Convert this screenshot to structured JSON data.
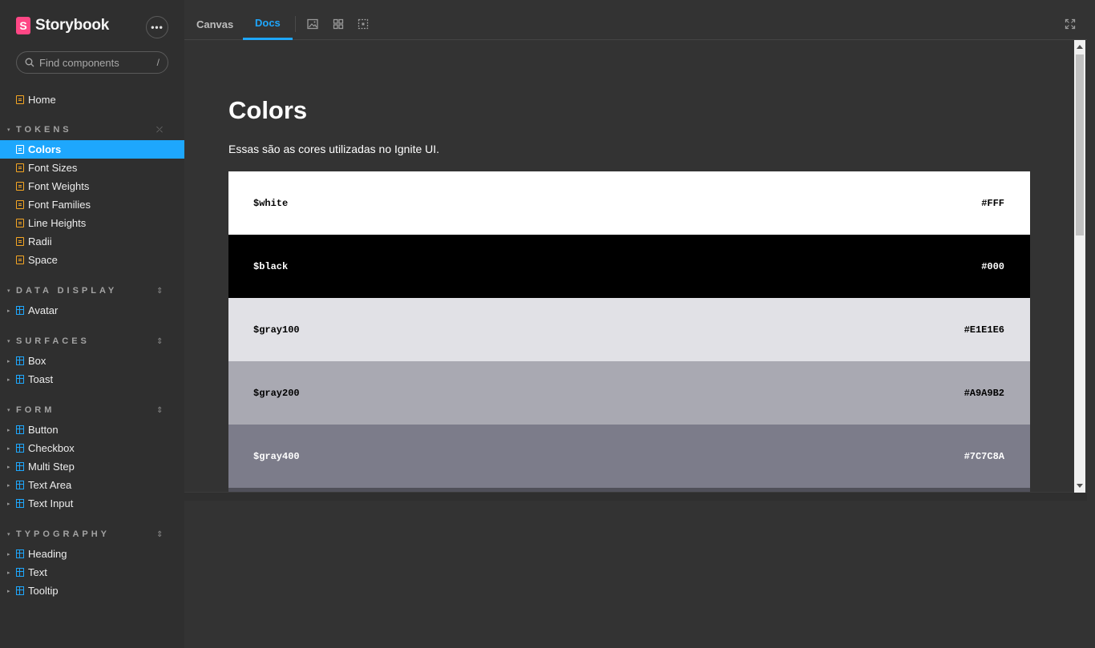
{
  "brand": {
    "logo_letter": "S",
    "name": "Storybook"
  },
  "sidebar": {
    "more_label": "•••",
    "search": {
      "placeholder": "Find components",
      "shortcut": "/"
    },
    "home": {
      "label": "Home"
    },
    "groups": [
      {
        "title": "TOKENS",
        "toggle": "⤫",
        "items": [
          {
            "label": "Colors",
            "active": true
          },
          {
            "label": "Font Sizes"
          },
          {
            "label": "Font Weights"
          },
          {
            "label": "Font Families"
          },
          {
            "label": "Line Heights"
          },
          {
            "label": "Radii"
          },
          {
            "label": "Space"
          }
        ]
      },
      {
        "title": "DATA DISPLAY",
        "toggle": "⇕",
        "items": [
          {
            "label": "Avatar"
          }
        ]
      },
      {
        "title": "SURFACES",
        "toggle": "⇕",
        "items": [
          {
            "label": "Box"
          },
          {
            "label": "Toast"
          }
        ]
      },
      {
        "title": "FORM",
        "toggle": "⇕",
        "items": [
          {
            "label": "Button"
          },
          {
            "label": "Checkbox"
          },
          {
            "label": "Multi Step"
          },
          {
            "label": "Text Area"
          },
          {
            "label": "Text Input"
          }
        ]
      },
      {
        "title": "TYPOGRAPHY",
        "toggle": "⇕",
        "items": [
          {
            "label": "Heading"
          },
          {
            "label": "Text"
          },
          {
            "label": "Tooltip"
          }
        ]
      }
    ]
  },
  "toolbar": {
    "tabs": [
      {
        "label": "Canvas"
      },
      {
        "label": "Docs",
        "active": true
      }
    ],
    "tools": [
      "image-icon",
      "grid-icon",
      "outline-icon"
    ],
    "fullscreen": "fullscreen-icon"
  },
  "doc": {
    "title": "Colors",
    "description": "Essas são as cores utilizadas no Ignite UI.",
    "swatches": [
      {
        "name": "$white",
        "hex": "#FFF",
        "color": "#FFFFFF",
        "text_color": "#000000"
      },
      {
        "name": "$black",
        "hex": "#000",
        "color": "#000000",
        "text_color": "#FFFFFF"
      },
      {
        "name": "$gray100",
        "hex": "#E1E1E6",
        "color": "#E1E1E6",
        "text_color": "#000000"
      },
      {
        "name": "$gray200",
        "hex": "#A9A9B2",
        "color": "#A9A9B2",
        "text_color": "#000000"
      },
      {
        "name": "$gray400",
        "hex": "#7C7C8A",
        "color": "#7C7C8A",
        "text_color": "#FFFFFF"
      },
      {
        "name": "",
        "hex": "",
        "color": "#505059",
        "text_color": "#FFFFFF"
      }
    ]
  },
  "colors": {
    "accent": "#1ea7fd",
    "brand": "#ff4785",
    "doc_icon": "#f5a623"
  }
}
